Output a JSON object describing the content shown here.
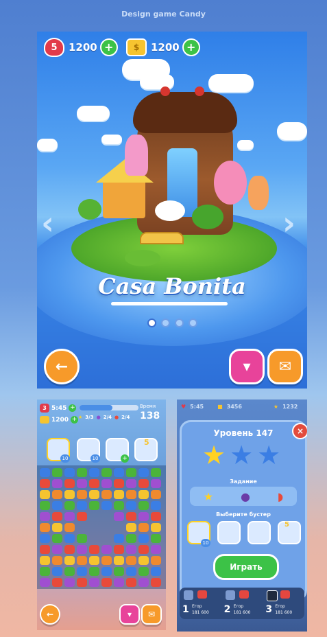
{
  "page_title": "Design game Candy",
  "main": {
    "lives": "5",
    "lives_count": "1200",
    "coins": "1200",
    "location_name": "Casa Bonita",
    "page_dots": 4,
    "active_dot": 0
  },
  "level_screen": {
    "lives": "3",
    "timer": "5:45",
    "coins": "1200",
    "progress_counts": [
      "3/3",
      "2/4",
      "2/4"
    ],
    "time_label": "Время",
    "time_value": "138",
    "booster_counts": [
      "10",
      "10",
      "5"
    ]
  },
  "level_popup": {
    "top_timer": "5:45",
    "top_coins": "3456",
    "top_stars": "1232",
    "title": "Уровень 147",
    "task_label": "Задание",
    "booster_label": "Выберите бустер",
    "booster_counts": [
      "10",
      "5"
    ],
    "play_label": "Играть",
    "leaderboard": [
      {
        "rank": "1",
        "name": "Егор",
        "score": "181 600"
      },
      {
        "rank": "2",
        "name": "Егор",
        "score": "181 600"
      },
      {
        "rank": "3",
        "name": "Егор",
        "score": "181 600"
      }
    ]
  },
  "colors": {
    "accent_green": "#3cc247",
    "heart_red": "#e23a4a",
    "gold": "#f6c430"
  }
}
